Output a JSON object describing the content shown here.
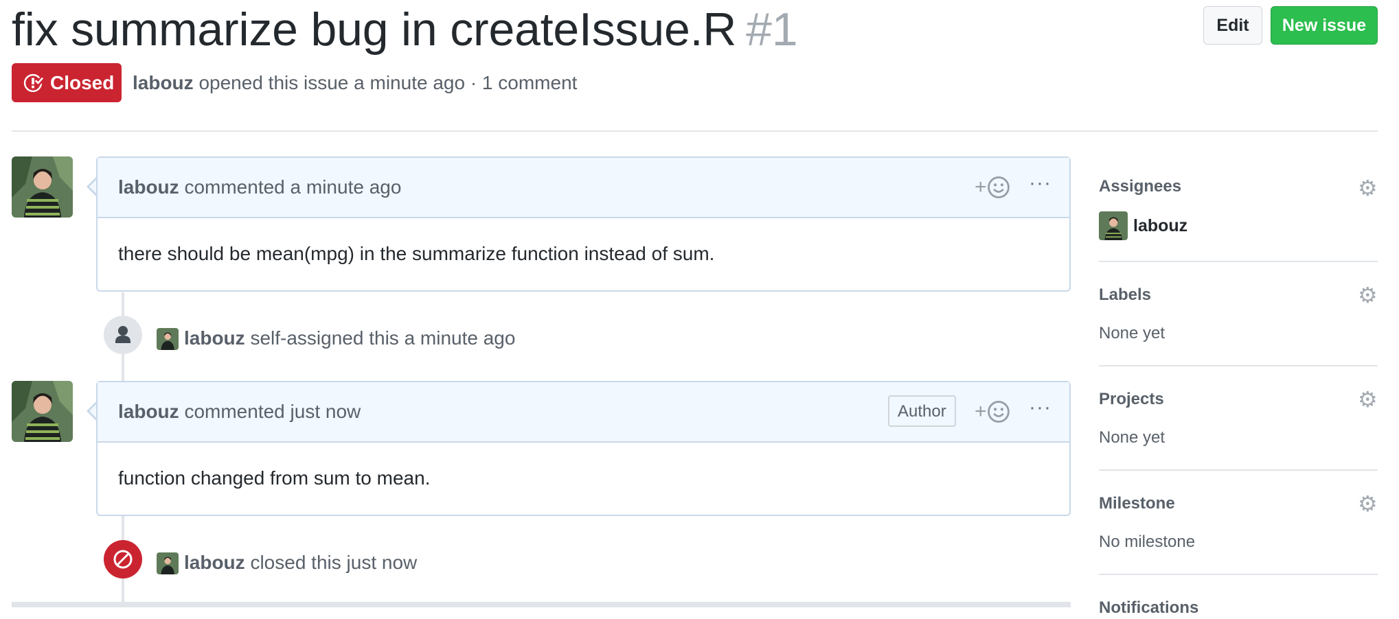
{
  "issue": {
    "title": "fix summarize bug in createIssue.R",
    "number": "#1",
    "state": "Closed",
    "author": "labouz",
    "meta_text": "opened this issue a minute ago · 1 comment"
  },
  "header_buttons": {
    "edit": "Edit",
    "new_issue": "New issue"
  },
  "comments": [
    {
      "author": "labouz",
      "time": "commented a minute ago",
      "body": "there should be mean(mpg) in the summarize function instead of sum.",
      "badge": ""
    },
    {
      "author": "labouz",
      "time": "commented just now",
      "body": "function changed from sum to mean.",
      "badge": "Author"
    }
  ],
  "reaction_label": "+",
  "more_label": "···",
  "events": [
    {
      "actor": "labouz",
      "text": "self-assigned this a minute ago",
      "icon": "person-icon"
    },
    {
      "actor": "labouz",
      "text": "closed this just now",
      "icon": "circle-slash-icon"
    }
  ],
  "sidebar": {
    "assignees": {
      "heading": "Assignees",
      "value": "labouz"
    },
    "labels": {
      "heading": "Labels",
      "value": "None yet"
    },
    "projects": {
      "heading": "Projects",
      "value": "None yet"
    },
    "milestone": {
      "heading": "Milestone",
      "value": "No milestone"
    },
    "notifications": {
      "heading": "Notifications"
    }
  },
  "colors": {
    "closed": "#cb2431",
    "new_issue": "#2cbe4e",
    "comment_header": "#f1f8ff"
  }
}
